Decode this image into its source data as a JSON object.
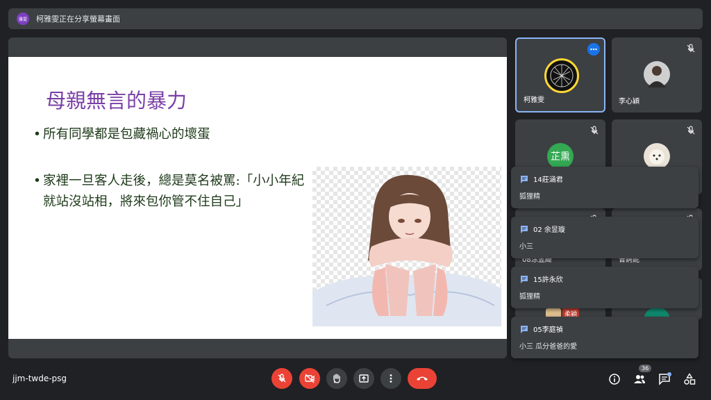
{
  "banner": {
    "avatar_text": "雅雯",
    "text": "柯雅雯正在分享螢幕畫面"
  },
  "slide": {
    "title": "母親無言的暴力",
    "bullets": [
      "所有同學都是包藏禍心的壞蛋",
      "家裡一旦客人走後，總是莫名被罵:「小小年紀就站沒站相，將來包你管不住自己」"
    ],
    "bullet_marker": "•"
  },
  "participants": [
    {
      "name": "柯雅雯"
    },
    {
      "name": "李心穎"
    },
    {
      "name": "",
      "avatar_text": "芷熏"
    },
    {
      "name": ""
    },
    {
      "name": "08涂昱綺"
    },
    {
      "name": "曾婀妮"
    },
    {
      "badge": "柔穎"
    },
    {
      "name": ""
    }
  ],
  "chat_notifications": [
    {
      "sender": "14莊涵君",
      "message": "狐狸精"
    },
    {
      "sender": "02 余昱璇",
      "message": "小三"
    },
    {
      "sender": "15許永欣",
      "message": "狐狸精"
    },
    {
      "sender": "05李庭禎",
      "message": "小三 瓜分爸爸的愛"
    }
  ],
  "meeting": {
    "code": "jjm-twde-psg"
  },
  "toolbar": {
    "people_count": "36"
  },
  "colors": {
    "end_call": "#ea4335",
    "active_border": "#8ab4f8",
    "slide_title": "#7a3fa6"
  },
  "icons": [
    "mic-off-icon",
    "camera-off-icon",
    "raise-hand-icon",
    "present-icon",
    "more-options-icon",
    "end-call-icon",
    "info-icon",
    "people-icon",
    "chat-icon",
    "activities-icon"
  ]
}
